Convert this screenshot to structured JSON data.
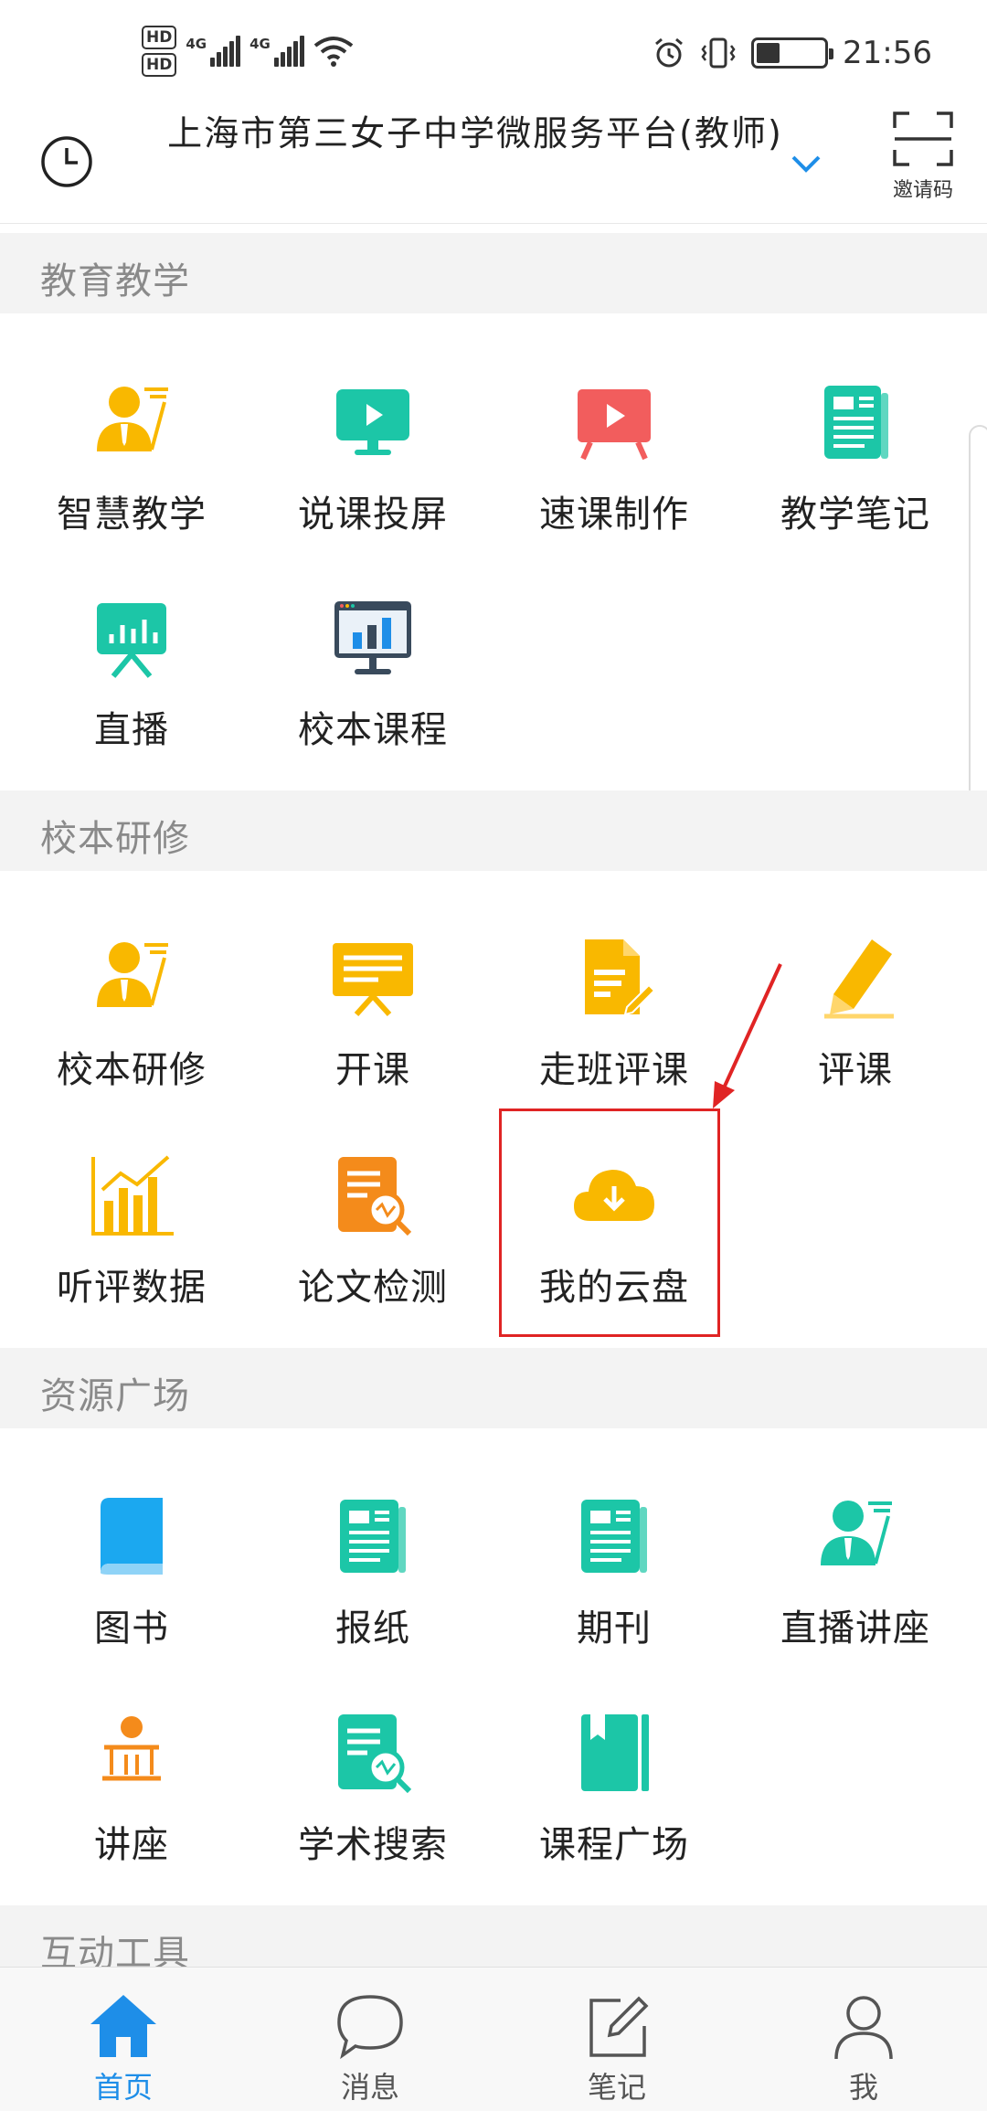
{
  "status_bar": {
    "hd1": "HD",
    "hd2": "HD",
    "sim1_network": "4G",
    "sim2_network": "4G",
    "time": "21:56",
    "battery_level": 0.35
  },
  "header": {
    "title": "上海市第三女子中学微服务平台(教师)",
    "invite_label": "邀请码"
  },
  "sections": [
    {
      "title": "教育教学",
      "items": [
        {
          "label": "智慧教学",
          "icon": "teacher-icon"
        },
        {
          "label": "说课投屏",
          "icon": "screen-cast-icon"
        },
        {
          "label": "速课制作",
          "icon": "quick-course-icon"
        },
        {
          "label": "教学笔记",
          "icon": "notes-icon"
        },
        {
          "label": "直播",
          "icon": "live-icon"
        },
        {
          "label": "校本课程",
          "icon": "monitor-chart-icon"
        }
      ]
    },
    {
      "title": "校本研修",
      "items": [
        {
          "label": "校本研修",
          "icon": "teacher-icon"
        },
        {
          "label": "开课",
          "icon": "whiteboard-icon"
        },
        {
          "label": "走班评课",
          "icon": "document-edit-icon"
        },
        {
          "label": "评课",
          "icon": "pencil-icon"
        },
        {
          "label": "听评数据",
          "icon": "bar-chart-icon"
        },
        {
          "label": "论文检测",
          "icon": "paper-check-icon"
        },
        {
          "label": "我的云盘",
          "icon": "cloud-download-icon"
        }
      ]
    },
    {
      "title": "资源广场",
      "items": [
        {
          "label": "图书",
          "icon": "book-icon"
        },
        {
          "label": "报纸",
          "icon": "newspaper-icon"
        },
        {
          "label": "期刊",
          "icon": "journal-icon"
        },
        {
          "label": "直播讲座",
          "icon": "lecture-icon"
        },
        {
          "label": "讲座",
          "icon": "podium-icon"
        },
        {
          "label": "学术搜索",
          "icon": "academic-search-icon"
        },
        {
          "label": "课程广场",
          "icon": "course-book-icon"
        }
      ]
    },
    {
      "title": "互动工具",
      "items": []
    }
  ],
  "bottom_nav": [
    {
      "label": "首页",
      "icon": "home-icon",
      "active": true
    },
    {
      "label": "消息",
      "icon": "message-icon",
      "active": false
    },
    {
      "label": "笔记",
      "icon": "note-edit-icon",
      "active": false
    },
    {
      "label": "我",
      "icon": "user-icon",
      "active": false
    }
  ],
  "colors": {
    "accent_blue": "#1e8ee8",
    "yellow": "#f9b800",
    "teal": "#1cc6a7",
    "coral": "#f25d5d",
    "highlight_red": "#e02424"
  }
}
